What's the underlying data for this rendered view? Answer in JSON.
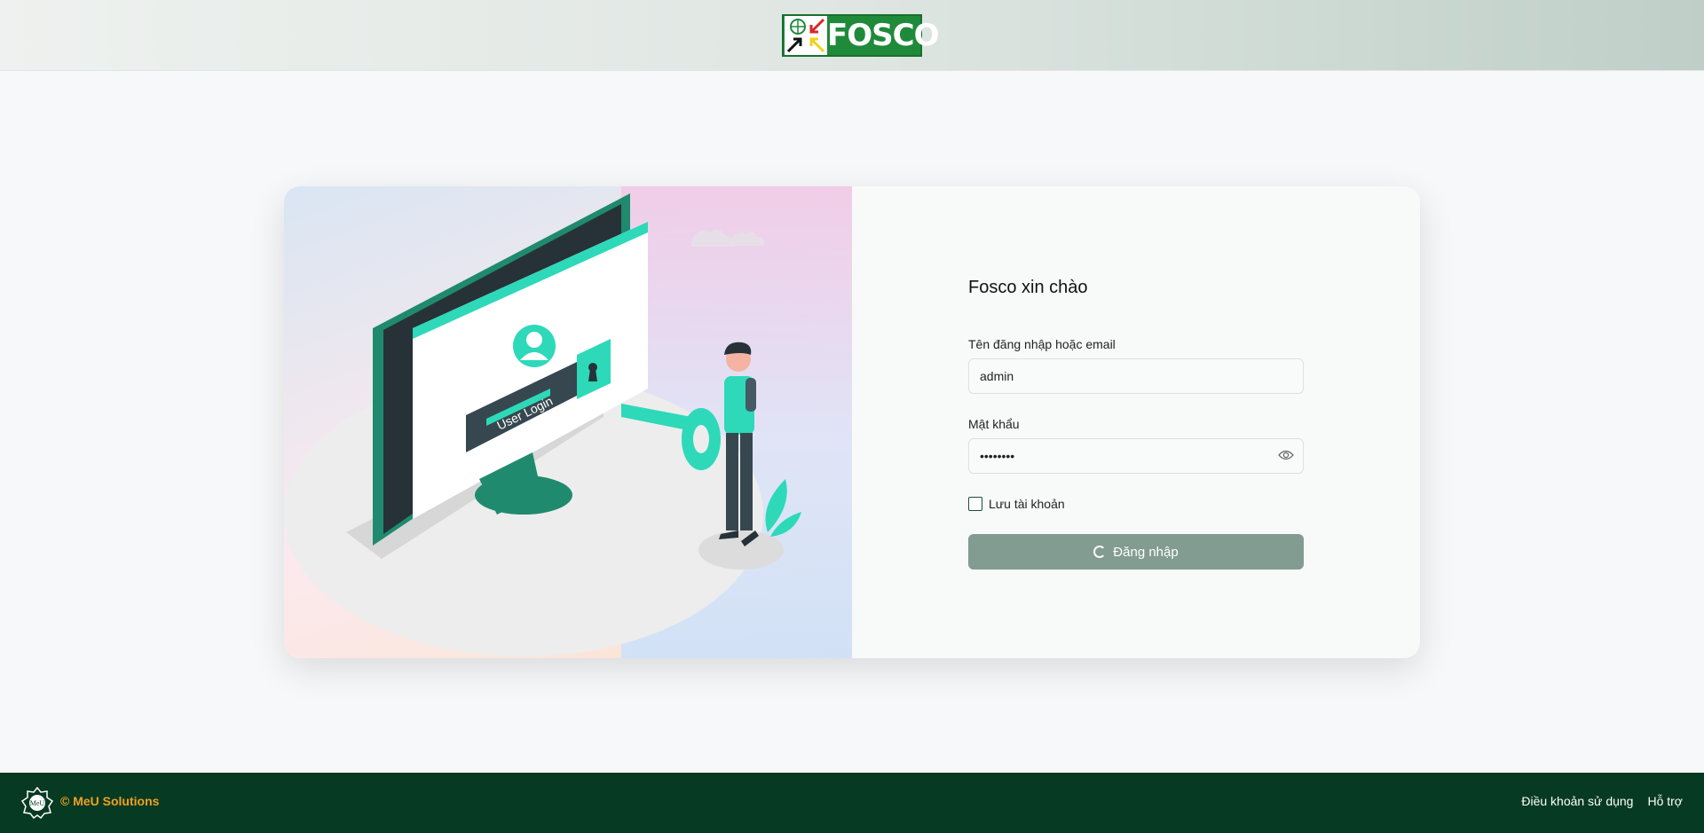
{
  "header": {
    "logo_text": "FOSCO",
    "logo_icon": "fosco-logo",
    "brand_colors": {
      "green": "#1f8a3a"
    }
  },
  "illustration": {
    "screen_text": "User Login",
    "description_icon": "user-login-illustration-icon"
  },
  "login": {
    "title": "Fosco xin chào",
    "username_label": "Tên đăng nhập hoặc email",
    "username_value": "admin",
    "password_label": "Mật khẩu",
    "password_value": "••••••••",
    "remember_label": "Lưu tài khoản",
    "submit_label": "Đăng nhập",
    "button_color": "#829c91"
  },
  "footer": {
    "copyright": "© MeU Solutions",
    "logo_text": "MeU",
    "links": [
      "Điều khoản sử dụng",
      "Hỗ trợ"
    ],
    "background": "#073a22",
    "accent": "#f0a020"
  }
}
